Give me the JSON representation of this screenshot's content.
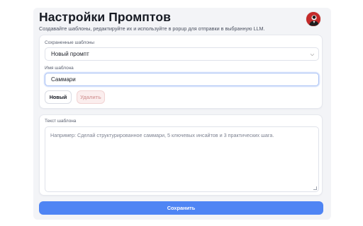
{
  "header": {
    "title": "Настройки Промптов",
    "subtitle": "Создавайте шаблоны, редактируйте их и используйте в popup для отправки в выбранную LLM."
  },
  "avatar": {
    "icon": "user-avatar",
    "color": "#c42a2a"
  },
  "templates": {
    "saved_label": "Сохраненные шаблоны",
    "selected": "Новый промпт",
    "name_label": "Имя шаблона",
    "name_value": "Саммари",
    "new_button": "Новый",
    "delete_button": "Удалить"
  },
  "template_text": {
    "label": "Текст шаблона",
    "placeholder": "Например: Сделай структурированное саммари, 5 ключевых инсайтов и 3 практических шага."
  },
  "footer": {
    "save_button": "Сохранить"
  },
  "colors": {
    "accent": "#4f85f4",
    "danger_bg": "#fbeeee",
    "danger_text": "#d9a3a3"
  }
}
